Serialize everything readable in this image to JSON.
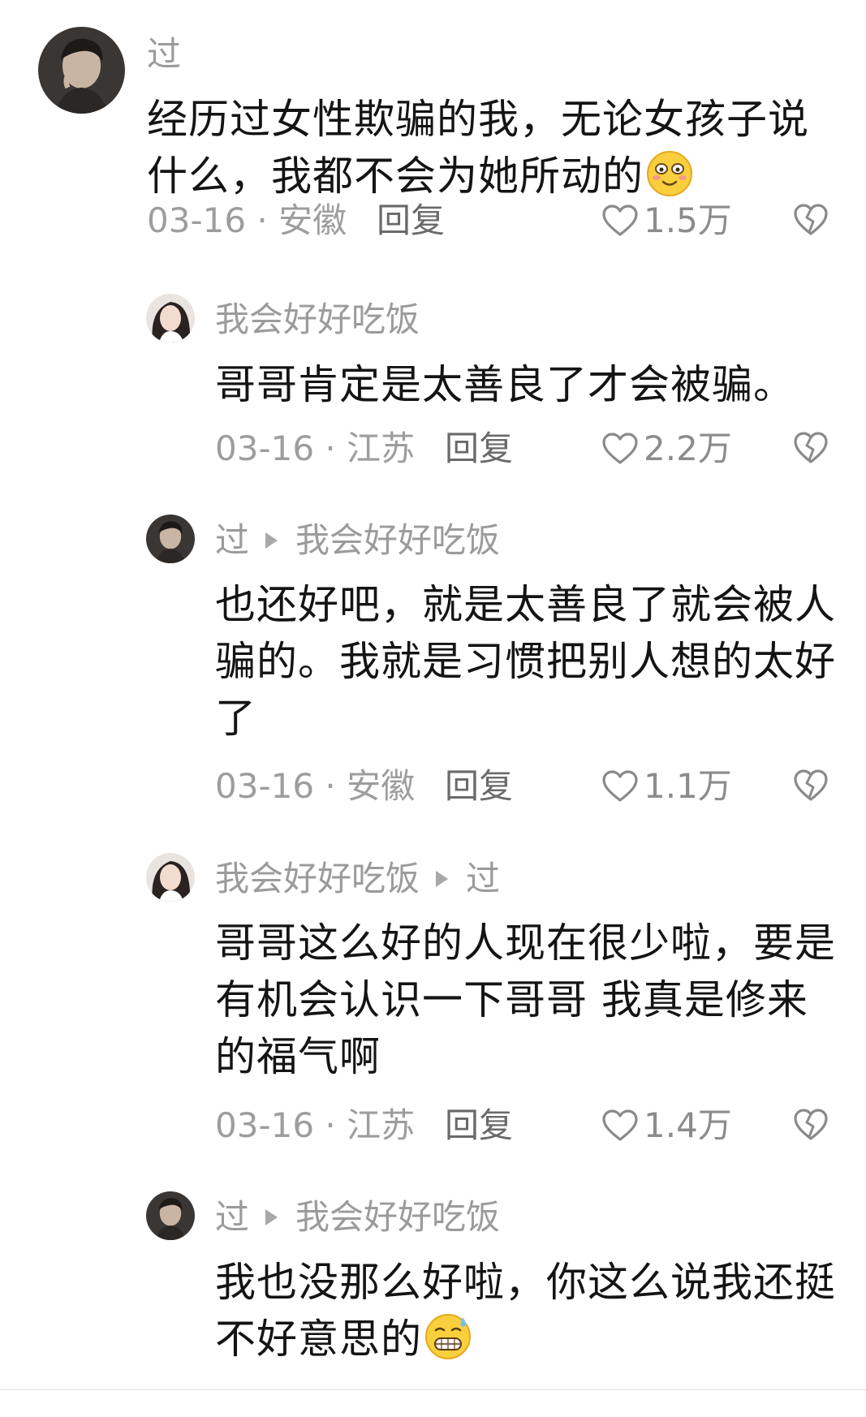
{
  "comments": [
    {
      "author": "过",
      "reply_to": "",
      "lines": [
        "经历过女性欺骗的我，无论女孩子说",
        "什么，我都不会为她所动的"
      ],
      "emoji": "blush-smile-emoji",
      "date_location": "03-16 · 安徽",
      "reply_label": "回复",
      "likes": "1.5万"
    },
    {
      "author": "我会好好吃饭",
      "reply_to": "",
      "lines": [
        "哥哥肯定是太善良了才会被骗。"
      ],
      "emoji": "",
      "date_location": "03-16 · 江苏",
      "reply_label": "回复",
      "likes": "2.2万"
    },
    {
      "author": "过",
      "reply_to": "我会好好吃饭",
      "lines": [
        "也还好吧，就是太善良了就会被人",
        "骗的。我就是习惯把别人想的太好",
        "了"
      ],
      "emoji": "",
      "date_location": "03-16 · 安徽",
      "reply_label": "回复",
      "likes": "1.1万"
    },
    {
      "author": "我会好好吃饭",
      "reply_to": "过",
      "lines": [
        "哥哥这么好的人现在很少啦，要是",
        "有机会认识一下哥哥 我真是修来",
        "的福气啊"
      ],
      "emoji": "",
      "date_location": "03-16 · 江苏",
      "reply_label": "回复",
      "likes": "1.4万"
    },
    {
      "author": "过",
      "reply_to": "我会好好吃饭",
      "lines": [
        "我也没那么好啦，你这么说我还挺",
        "不好意思的"
      ],
      "emoji": "grin-sweat-emoji",
      "date_location": "",
      "reply_label": "",
      "likes": ""
    }
  ]
}
